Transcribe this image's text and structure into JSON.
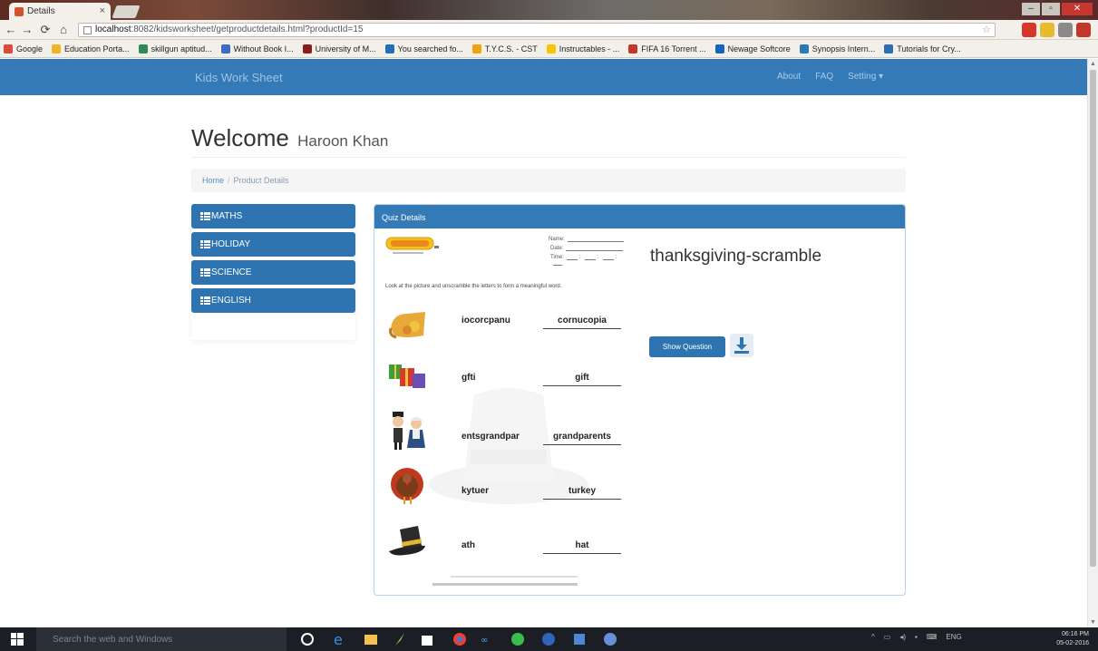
{
  "browser": {
    "tab_title": "Details",
    "tab_close": "×",
    "url_host": "localhost",
    "url_rest": ":8082/kidsworksheet/getproductdetails.html?productId=15",
    "window_controls": [
      "–",
      "▫",
      "✕"
    ],
    "nav_icons": [
      "back-arrow",
      "forward-arrow",
      "reload",
      "home"
    ],
    "bookmarks": [
      {
        "label": "Google",
        "color": "#e0483e"
      },
      {
        "label": "Education Porta...",
        "color": "#f0b323"
      },
      {
        "label": "skillgun aptitud...",
        "color": "#2e8b57"
      },
      {
        "label": "Without Book I...",
        "color": "#3b6cc7"
      },
      {
        "label": "University of M...",
        "color": "#8c1d1d"
      },
      {
        "label": "You searched fo...",
        "color": "#1e6fb8"
      },
      {
        "label": "T.Y.C.S. - CST",
        "color": "#f2a20c"
      },
      {
        "label": "Instructables - ...",
        "color": "#f7c600"
      },
      {
        "label": "FIFA 16 Torrent ...",
        "color": "#c0392b"
      },
      {
        "label": "Newage Softcore",
        "color": "#1565c0"
      },
      {
        "label": "Synopsis Intern...",
        "color": "#2a7ab8"
      },
      {
        "label": "Tutorials for Cry...",
        "color": "#2f6db5"
      }
    ]
  },
  "site": {
    "brand": "Kids Work Sheet",
    "nav_links": [
      "About",
      "FAQ",
      "Setting ▾"
    ],
    "accent_color": "#337ab7"
  },
  "page": {
    "welcome_label": "Welcome",
    "user_name": "Haroon Khan",
    "breadcrumb": {
      "home": "Home",
      "separator": "/",
      "current": "Product Details"
    }
  },
  "sidebar": {
    "categories": [
      "MATHS",
      "HOLIDAY",
      "SCIENCE",
      "ENGLISH"
    ]
  },
  "panel": {
    "header": "Quiz Details",
    "title": "thanksgiving-scramble",
    "show_button": "Show Question",
    "download_icon": "download-icon"
  },
  "worksheet": {
    "name_label": "Name:",
    "date_label": "Date:",
    "time_label": "Time:",
    "instruction": "Look at the picture and unscramble the letters to form a meaningful word.",
    "items": [
      {
        "picture": "cornucopia-picture",
        "scrambled": "iocorcpanu",
        "answer": "cornucopia"
      },
      {
        "picture": "gift-picture",
        "scrambled": "gfti",
        "answer": "gift"
      },
      {
        "picture": "grandparents-picture",
        "scrambled": "entsgrandpar",
        "answer": "grandparents"
      },
      {
        "picture": "turkey-picture",
        "scrambled": "kytuer",
        "answer": "turkey"
      },
      {
        "picture": "hat-picture",
        "scrambled": "ath",
        "answer": "hat"
      }
    ]
  },
  "taskbar": {
    "search_placeholder": "Search the web and Windows",
    "tray_text": [
      "^",
      "ENG"
    ],
    "time": "06:16 PM",
    "date": "05-02-2016"
  }
}
